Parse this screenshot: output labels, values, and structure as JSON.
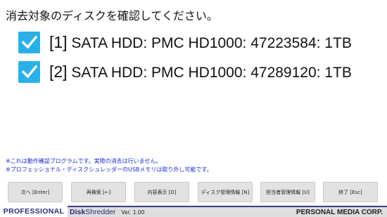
{
  "prompt": "消去対象のディスクを確認してください。",
  "disks": [
    {
      "index": "[1]",
      "description": "SATA HDD: PMC HD1000: 47223584: 1TB",
      "checked": true
    },
    {
      "index": "[2]",
      "description": "SATA HDD: PMC HD1000: 47289120: 1TB",
      "checked": true
    }
  ],
  "notes": [
    "※これは動作確認プログラムです。実際の消去は行いません。",
    "※プロフェッショナル・ディスクシュレッダーのUSBメモリは取り外し可能です。"
  ],
  "buttons": {
    "next": "次へ [Enter]",
    "rescan": "再検索 [←]",
    "content": "内容表示 [D]",
    "disk_info": "ディスク管理情報 [N]",
    "operator_info": "担当者管理情報 [U]",
    "exit": "終了 [Esc]"
  },
  "footer": {
    "brand": "PROFESSIONAL",
    "product_bold": "Disk",
    "product_rest": "Shredder",
    "version": "Ver. 1.00",
    "company": "PERSONAL MEDIA CORP."
  },
  "colors": {
    "checkbox": "#2ab0e6",
    "notes": "#1b2ad6",
    "brand": "#2c2d7a"
  }
}
